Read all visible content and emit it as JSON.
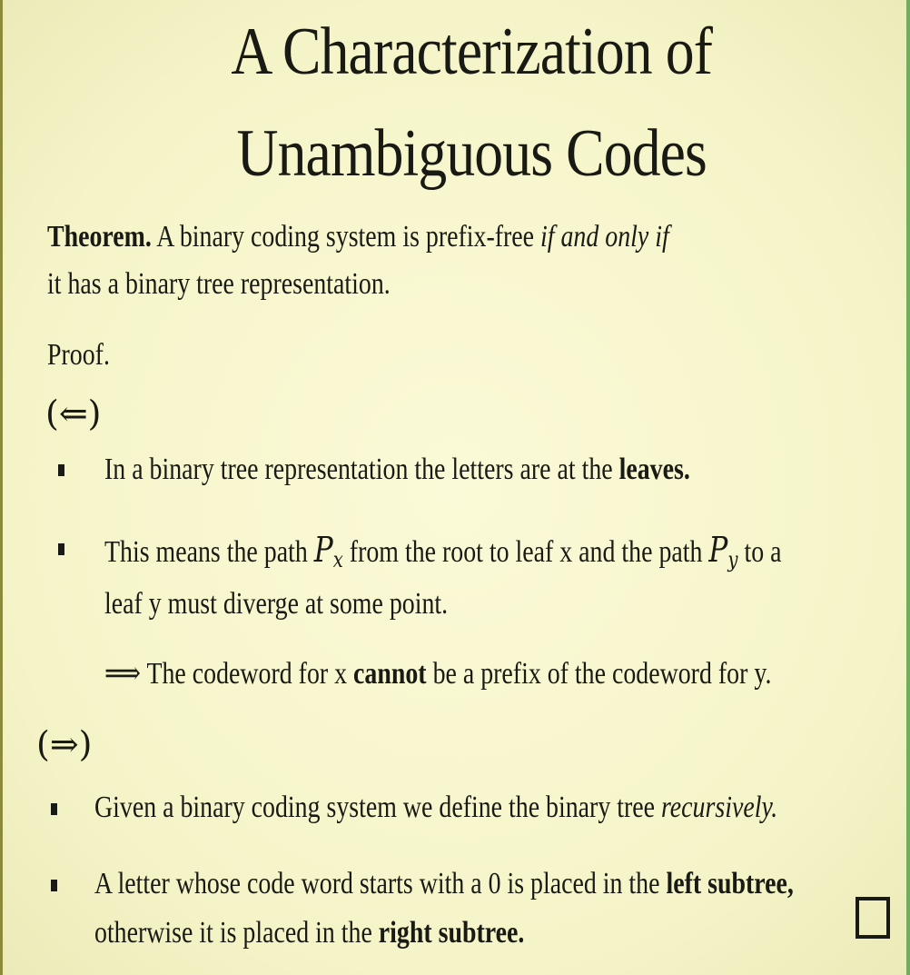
{
  "title": {
    "line1": "A Characterization of",
    "line2": "Unambiguous Codes"
  },
  "theorem": {
    "label": "Theorem.",
    "text_part1": "A binary coding system is prefix-free",
    "emphasis": "if and only if",
    "text_part2": "it has a binary tree representation."
  },
  "proof": {
    "label": "Proof.",
    "backward": {
      "symbol": "(⇐)",
      "bullet1": {
        "text": "In a binary tree representation the letters are at the",
        "bold": "leaves."
      },
      "bullet2": {
        "part1": "This means the path",
        "math1": "P",
        "math1_sub": "x",
        "part2": "from the root to leaf x and the path",
        "math2": "P",
        "math2_sub": "y",
        "part3": "to a",
        "line2": "leaf y must diverge at some point."
      },
      "implication": {
        "arrow": "⟹",
        "part1": "The codeword for x",
        "bold": "cannot",
        "part2": "be a prefix of the codeword for y."
      }
    },
    "forward": {
      "symbol": "(⇒)",
      "bullet1": {
        "text": "Given a binary coding system we define the binary tree",
        "italic": "recursively."
      },
      "bullet2": {
        "part1": "A letter whose code word starts with a 0 is placed in the",
        "bold1": "left subtree,",
        "line2_part1": "otherwise it is placed in the",
        "bold2": "right subtree."
      }
    }
  }
}
